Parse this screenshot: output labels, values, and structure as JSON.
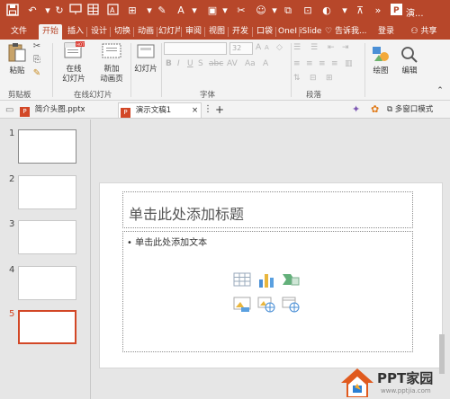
{
  "window": {
    "title_short": "演..."
  },
  "qat": {
    "icons": [
      "save-icon",
      "undo-icon",
      "redo-icon",
      "slideshow-icon",
      "table-icon",
      "text-box-icon",
      "shape-icon",
      "font-color-icon",
      "sort-icon",
      "format-painter-icon",
      "sync-icon",
      "group-icon",
      "customize-icon"
    ]
  },
  "window_buttons": {
    "icons": [
      "ribbon-display-icon",
      "minimize-icon"
    ]
  },
  "tabs": [
    {
      "label": "文件",
      "active": false
    },
    {
      "label": "开始",
      "active": true
    },
    {
      "label": "插入",
      "active": false
    },
    {
      "label": "设计",
      "active": false
    },
    {
      "label": "切换",
      "active": false
    },
    {
      "label": "动画",
      "active": false
    },
    {
      "label": "幻灯片",
      "active": false
    },
    {
      "label": "审阅",
      "active": false
    },
    {
      "label": "视图",
      "active": false
    },
    {
      "label": "开发",
      "active": false
    },
    {
      "label": "口袋",
      "active": false
    },
    {
      "label": "OneI",
      "active": false
    },
    {
      "label": "iSlide",
      "active": false
    }
  ],
  "tell_me": "告诉我...",
  "account": {
    "login": "登录",
    "share": "共享"
  },
  "ribbon": {
    "paste": "粘贴",
    "online_slides_top": "在线",
    "online_slides_bottom": "幻灯片",
    "new_anim_top": "新加",
    "new_anim_bottom": "动画页",
    "slides_btn": "幻灯片",
    "font_size": "32",
    "draw": "绘图",
    "edit": "编辑",
    "groups": {
      "clipboard": "剪贴板",
      "online": "在线幻灯片",
      "font": "字体",
      "paragraph": "段落"
    }
  },
  "doc_tabs": [
    {
      "label": "简介头图.pptx",
      "active": false
    },
    {
      "label": "演示文稿1",
      "active": true
    }
  ],
  "doc_tabs_right": {
    "multiwindow": "多窗口模式"
  },
  "slides": [
    {
      "number": "1",
      "active": false
    },
    {
      "number": "2",
      "active": false
    },
    {
      "number": "3",
      "active": false
    },
    {
      "number": "4",
      "active": false
    },
    {
      "number": "5",
      "active": true
    }
  ],
  "editor": {
    "title_placeholder": "单击此处添加标题",
    "body_placeholder": "• 单击此处添加文本"
  },
  "watermark": {
    "brand": "PPT家园",
    "url": "www.pptjia.com"
  },
  "colors": {
    "accent": "#b7472a",
    "active_slide": "#d24726"
  }
}
